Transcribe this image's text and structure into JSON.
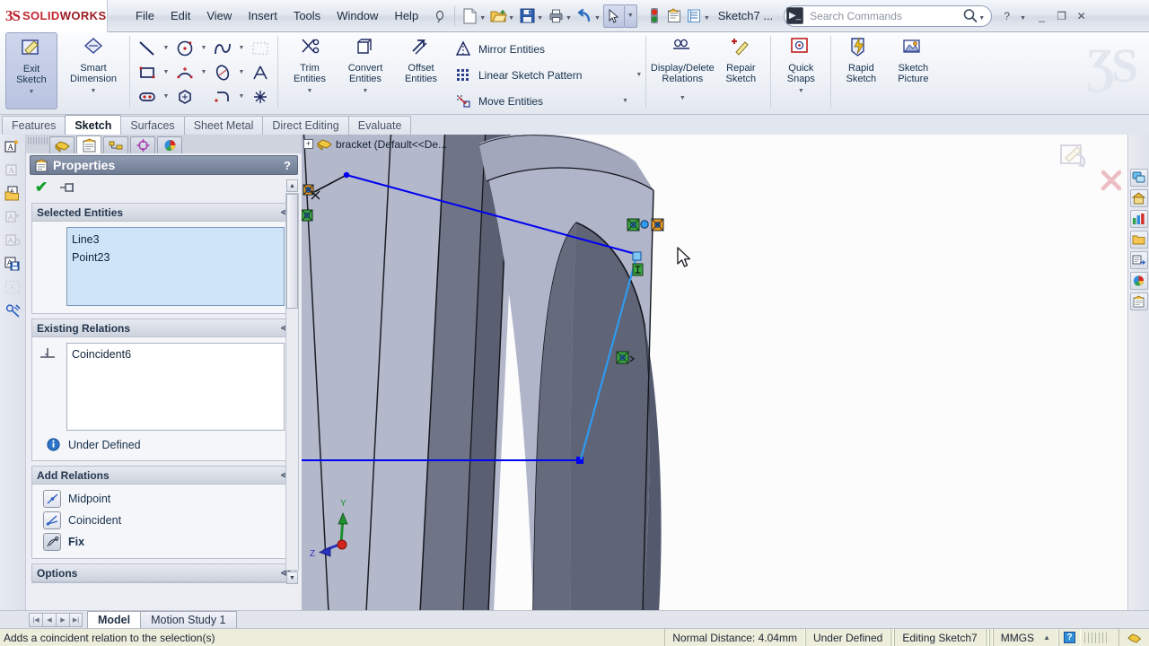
{
  "app": {
    "brand_mark": "3S",
    "brand_name_bold": "SOLID",
    "brand_name_light": "WORKS",
    "document_title": "Sketch7 ..."
  },
  "menubar": {
    "items": [
      {
        "label": "File"
      },
      {
        "label": "Edit"
      },
      {
        "label": "View"
      },
      {
        "label": "Insert"
      },
      {
        "label": "Tools"
      },
      {
        "label": "Window"
      },
      {
        "label": "Help"
      }
    ]
  },
  "search": {
    "placeholder": "Search Commands",
    "value": ""
  },
  "window_controls": {
    "help": "?",
    "minimize": "_",
    "restore": "❐",
    "close": "✕"
  },
  "ribbon": {
    "commands": [
      {
        "name": "exit-sketch",
        "line1": "Exit",
        "line2": "Sketch",
        "selected": true,
        "dropdown": true
      },
      {
        "name": "smart-dimension",
        "line1": "Smart",
        "line2": "Dimension",
        "selected": false,
        "dropdown": true
      },
      {
        "name": "trim-entities",
        "line1": "Trim",
        "line2": "Entities",
        "selected": false,
        "dropdown": true
      },
      {
        "name": "convert-entities",
        "line1": "Convert",
        "line2": "Entities",
        "selected": false,
        "dropdown": true
      },
      {
        "name": "offset-entities",
        "line1": "Offset",
        "line2": "Entities",
        "selected": false,
        "dropdown": false
      },
      {
        "name": "display-delete-relations",
        "line1": "Display/Delete",
        "line2": "Relations",
        "selected": false,
        "dropdown": true
      },
      {
        "name": "repair-sketch",
        "line1": "Repair",
        "line2": "Sketch",
        "selected": false,
        "dropdown": false
      },
      {
        "name": "quick-snaps",
        "line1": "Quick",
        "line2": "Snaps",
        "selected": false,
        "dropdown": true
      },
      {
        "name": "rapid-sketch",
        "line1": "Rapid",
        "line2": "Sketch",
        "selected": false,
        "dropdown": false
      },
      {
        "name": "sketch-picture",
        "line1": "Sketch",
        "line2": "Picture",
        "selected": false,
        "dropdown": false
      }
    ],
    "text_commands": [
      {
        "label": "Mirror Entities",
        "dropdown": false
      },
      {
        "label": "Linear Sketch Pattern",
        "dropdown": true
      },
      {
        "label": "Move Entities",
        "dropdown": true
      }
    ]
  },
  "tabs": {
    "items": [
      {
        "label": "Features",
        "active": false
      },
      {
        "label": "Sketch",
        "active": true
      },
      {
        "label": "Surfaces",
        "active": false
      },
      {
        "label": "Sheet Metal",
        "active": false
      },
      {
        "label": "Direct Editing",
        "active": false
      },
      {
        "label": "Evaluate",
        "active": false
      }
    ]
  },
  "property_manager": {
    "title": "Properties",
    "help_glyph": "?",
    "ok_glyph": "✔",
    "selected_entities": {
      "header": "Selected Entities",
      "items": [
        "Line3",
        "Point23"
      ]
    },
    "existing_relations": {
      "header": "Existing Relations",
      "items": [
        "Coincident6"
      ],
      "status": "Under Defined"
    },
    "add_relations": {
      "header": "Add Relations",
      "items": [
        {
          "label": "Midpoint",
          "bold": false
        },
        {
          "label": "Coincident",
          "bold": false
        },
        {
          "label": "Fix",
          "bold": true
        }
      ]
    },
    "options": {
      "header": "Options"
    }
  },
  "feature_tree": {
    "root_label": "bracket  (Default<<De..."
  },
  "model_tabs": {
    "items": [
      {
        "label": "Model",
        "active": true
      },
      {
        "label": "Motion Study 1",
        "active": false
      }
    ]
  },
  "status_bar": {
    "message": "Adds a coincident relation to the selection(s)",
    "normal_distance": "Normal Distance: 4.04mm",
    "defined_state": "Under Defined",
    "editing": "Editing Sketch7",
    "units": "MMGS",
    "units_caret": "▲",
    "help_badge": "?"
  },
  "colors": {
    "accent_blue": "#0000f0",
    "sketch_line_blue": "#2e9bf0",
    "selected_highlight": "#cfe5f7",
    "model_face_light": "#aeb3c8",
    "model_face_dark": "#5b6072",
    "brand_red": "#c3262f",
    "status_bg": "#ecedda"
  }
}
